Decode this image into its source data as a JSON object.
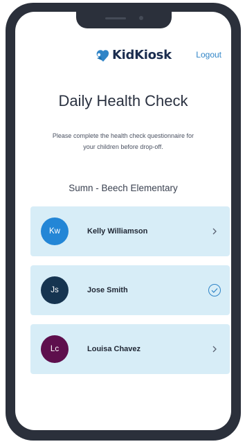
{
  "header": {
    "logo_text": "KidKiosk",
    "logout_label": "Logout"
  },
  "page": {
    "title": "Daily Health Check",
    "subtitle_line1": "Please complete the health check questionnaire for",
    "subtitle_line2": "your children before drop-off.",
    "school": "Sumn - Beech Elementary"
  },
  "children": [
    {
      "initials": "Kw",
      "name": "Kelly Williamson",
      "status": "pending",
      "avatar_color": "#2386d6",
      "action_icon": "chevron-right-icon"
    },
    {
      "initials": "Js",
      "name": "Jose Smith",
      "status": "completed",
      "avatar_color": "#163450",
      "action_icon": "check-circle-icon"
    },
    {
      "initials": "Lc",
      "name": "Louisa Chavez",
      "status": "pending",
      "avatar_color": "#5e0f4d",
      "action_icon": "chevron-right-icon"
    }
  ],
  "colors": {
    "accent": "#2f84c7",
    "card_background": "#d7edf7",
    "phone_frame": "#2b303b"
  }
}
